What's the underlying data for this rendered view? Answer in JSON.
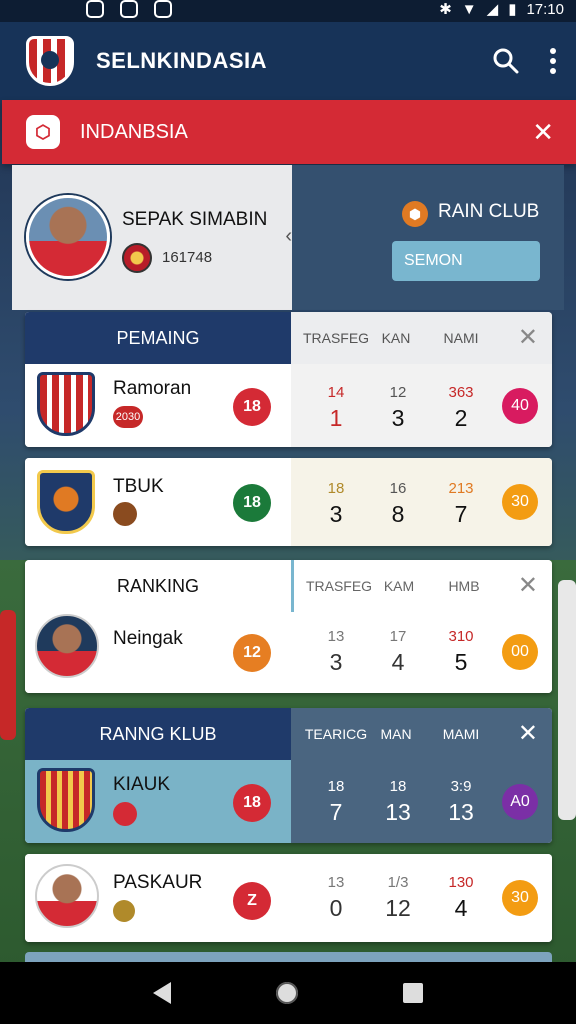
{
  "status_bar": {
    "time": "17:10"
  },
  "app_bar": {
    "title": "SELNKINDASIA"
  },
  "banner": {
    "title": "INDANBSIA"
  },
  "profile": {
    "name": "SEPAK SIMABIN",
    "code": "161748",
    "club_label": "RAIN CLUB",
    "season_button": "SEMON"
  },
  "cards": [
    {
      "header": {
        "title": "PEMAING",
        "cols": [
          "TRASFEG",
          "KAN",
          "NAMI"
        ]
      },
      "rows": [
        {
          "name": "Ramoran",
          "sub": "2030",
          "badge": "18",
          "stats": [
            [
              "14",
              "1"
            ],
            [
              "12",
              "3"
            ],
            [
              "363",
              "2"
            ]
          ],
          "end": "40"
        },
        {
          "name": "TBUK",
          "sub": "",
          "badge": "18",
          "stats": [
            [
              "18",
              "3"
            ],
            [
              "16",
              "8"
            ],
            [
              "213",
              "7"
            ]
          ],
          "end": "30"
        }
      ]
    },
    {
      "header": {
        "title": "RANKING",
        "cols": [
          "TRASFEG",
          "KAM",
          "HMB"
        ]
      },
      "rows": [
        {
          "name": "Neingak",
          "sub": "",
          "badge": "12",
          "stats": [
            [
              "13",
              "3"
            ],
            [
              "17",
              "4"
            ],
            [
              "310",
              "5"
            ]
          ],
          "end": "00"
        }
      ]
    },
    {
      "header": {
        "title": "RANNG KLUB",
        "cols": [
          "TEARICG",
          "MAN",
          "MAMI"
        ]
      },
      "rows": [
        {
          "name": "KIAUK",
          "sub": "",
          "badge": "18",
          "stats": [
            [
              "18",
              "7"
            ],
            [
              "18",
              "13"
            ],
            [
              "3:9",
              "13"
            ]
          ],
          "end": "A0"
        },
        {
          "name": "PASKAUR",
          "sub": "",
          "badge": "Z",
          "stats": [
            [
              "13",
              "0"
            ],
            [
              "1/3",
              "12"
            ],
            [
              "130",
              "4"
            ]
          ],
          "end": "30"
        }
      ]
    }
  ],
  "colors": {
    "app_bar": "#173358",
    "banner": "#d42a35",
    "card_header_dark": "#1f3a6a",
    "accent_blue": "#79b6cf"
  }
}
